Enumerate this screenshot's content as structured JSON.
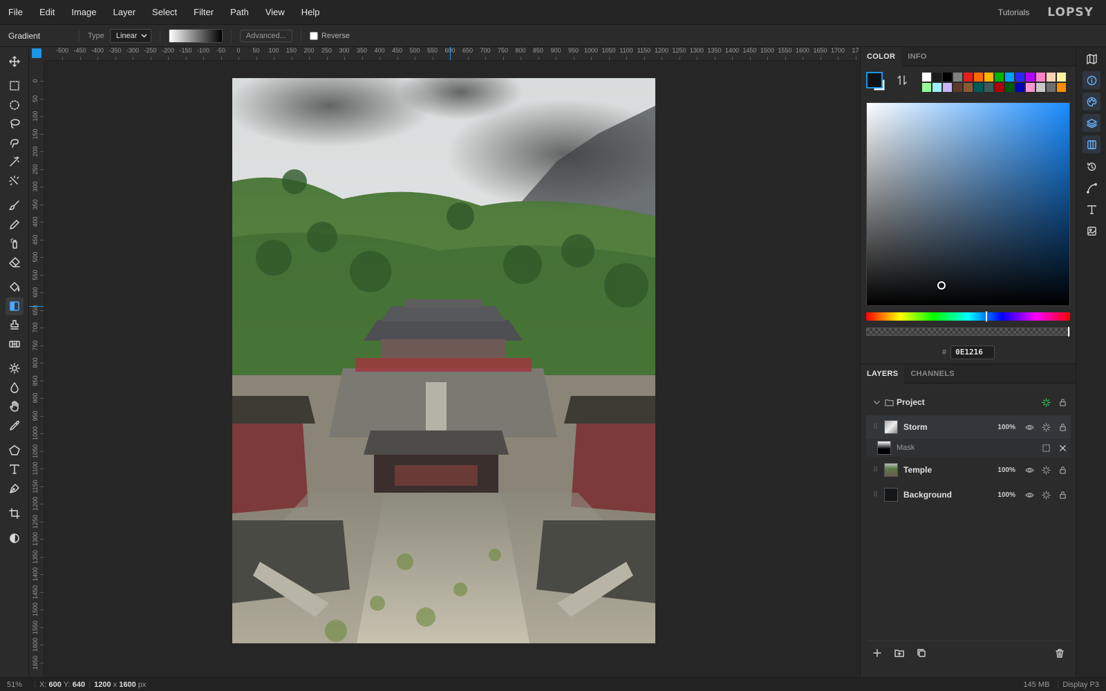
{
  "app": {
    "logo": "LOPSY",
    "tutorials_label": "Tutorials",
    "menu": [
      "File",
      "Edit",
      "Image",
      "Layer",
      "Select",
      "Filter",
      "Path",
      "View",
      "Help"
    ]
  },
  "options_bar": {
    "tool_name": "Gradient",
    "type_label": "Type",
    "type_value": "Linear",
    "advanced_label": "Advanced...",
    "reverse_label": "Reverse",
    "reverse_checked": false
  },
  "tools": [
    "move-icon",
    "rect-select-icon",
    "ellipse-select-icon",
    "lasso-icon",
    "magnetic-lasso-icon",
    "magic-wand-icon",
    "quick-select-icon",
    "brush-icon",
    "pencil-icon",
    "spray-icon",
    "eraser-icon",
    "paint-bucket-icon",
    "gradient-icon",
    "stamp-icon",
    "patch-icon",
    "dodge-icon",
    "blur-icon",
    "hand-icon",
    "eyedropper-icon",
    "polygon-icon",
    "text-icon",
    "pen-icon",
    "crop-icon",
    "contrast-icon"
  ],
  "active_tool": "gradient-icon",
  "ruler": {
    "top_labels": [
      "-500",
      "-450",
      "-400",
      "-350",
      "-300",
      "-250",
      "-200",
      "-150",
      "-100",
      "-50",
      "0",
      "50",
      "100",
      "150",
      "200",
      "250",
      "300",
      "350",
      "400",
      "450",
      "500",
      "550",
      "600",
      "650",
      "700",
      "750",
      "800",
      "850",
      "900",
      "950",
      "1000",
      "1050",
      "1100",
      "1150",
      "1200",
      "1250",
      "1300",
      "1350",
      "1400",
      "1450",
      "1500",
      "1550",
      "1600",
      "1650",
      "1700",
      "17"
    ],
    "left_labels": [
      "0",
      "50",
      "100",
      "150",
      "200",
      "250",
      "300",
      "350",
      "400",
      "450",
      "500",
      "550",
      "600",
      "650",
      "700",
      "750",
      "800",
      "850",
      "900",
      "950",
      "1000",
      "1050",
      "1100",
      "1150",
      "1200",
      "1250",
      "1300",
      "1350",
      "1400",
      "1450",
      "1500",
      "1550",
      "1600",
      "1650"
    ]
  },
  "color_panel": {
    "tabs": [
      "COLOR",
      "INFO"
    ],
    "active_tab": "COLOR",
    "hex_prefix": "#",
    "hex": "0E1216",
    "foreground": "#0e1216",
    "background": "#ffffff",
    "palette": [
      "#ffffff",
      "#1a1a1a",
      "#000000",
      "#808080",
      "#e61e1e",
      "#ff6a00",
      "#ffb400",
      "#00b400",
      "#00a0ff",
      "#2828ff",
      "#b400ff",
      "#ff82c8",
      "#ffd2b4",
      "#fff5a0",
      "#96ff96",
      "#a0f0ff",
      "#c8b4ff",
      "#5a3c28",
      "#8c5a32",
      "#005a5a",
      "#3c5a5a",
      "#b40000",
      "#005a00",
      "#0000b4",
      "#ff96d2",
      "#c8c8c8",
      "#6e6e6e",
      "#ff8c00"
    ]
  },
  "layers_panel": {
    "tabs": [
      "LAYERS",
      "CHANNELS"
    ],
    "active_tab": "LAYERS",
    "group": "Project",
    "layers": [
      {
        "name": "Storm",
        "opacity": "100%",
        "selected": true
      },
      {
        "name": "Mask",
        "opacity": "",
        "selected": false
      },
      {
        "name": "Temple",
        "opacity": "100%",
        "selected": false
      },
      {
        "name": "Background",
        "opacity": "100%",
        "selected": false
      }
    ]
  },
  "right_strip": [
    "map-icon",
    "info-icon",
    "palette-icon",
    "layers-icon",
    "columns-icon",
    "history-icon",
    "curve-icon",
    "text-icon",
    "image-icon"
  ],
  "status": {
    "zoom": "51%",
    "x_label": "X:",
    "x": "600",
    "y_label": "Y:",
    "y": "640",
    "doc_w": "1200",
    "doc_x": "x",
    "doc_h": "1600",
    "doc_unit": "px",
    "memory": "145 MB",
    "display": "Display P3"
  }
}
